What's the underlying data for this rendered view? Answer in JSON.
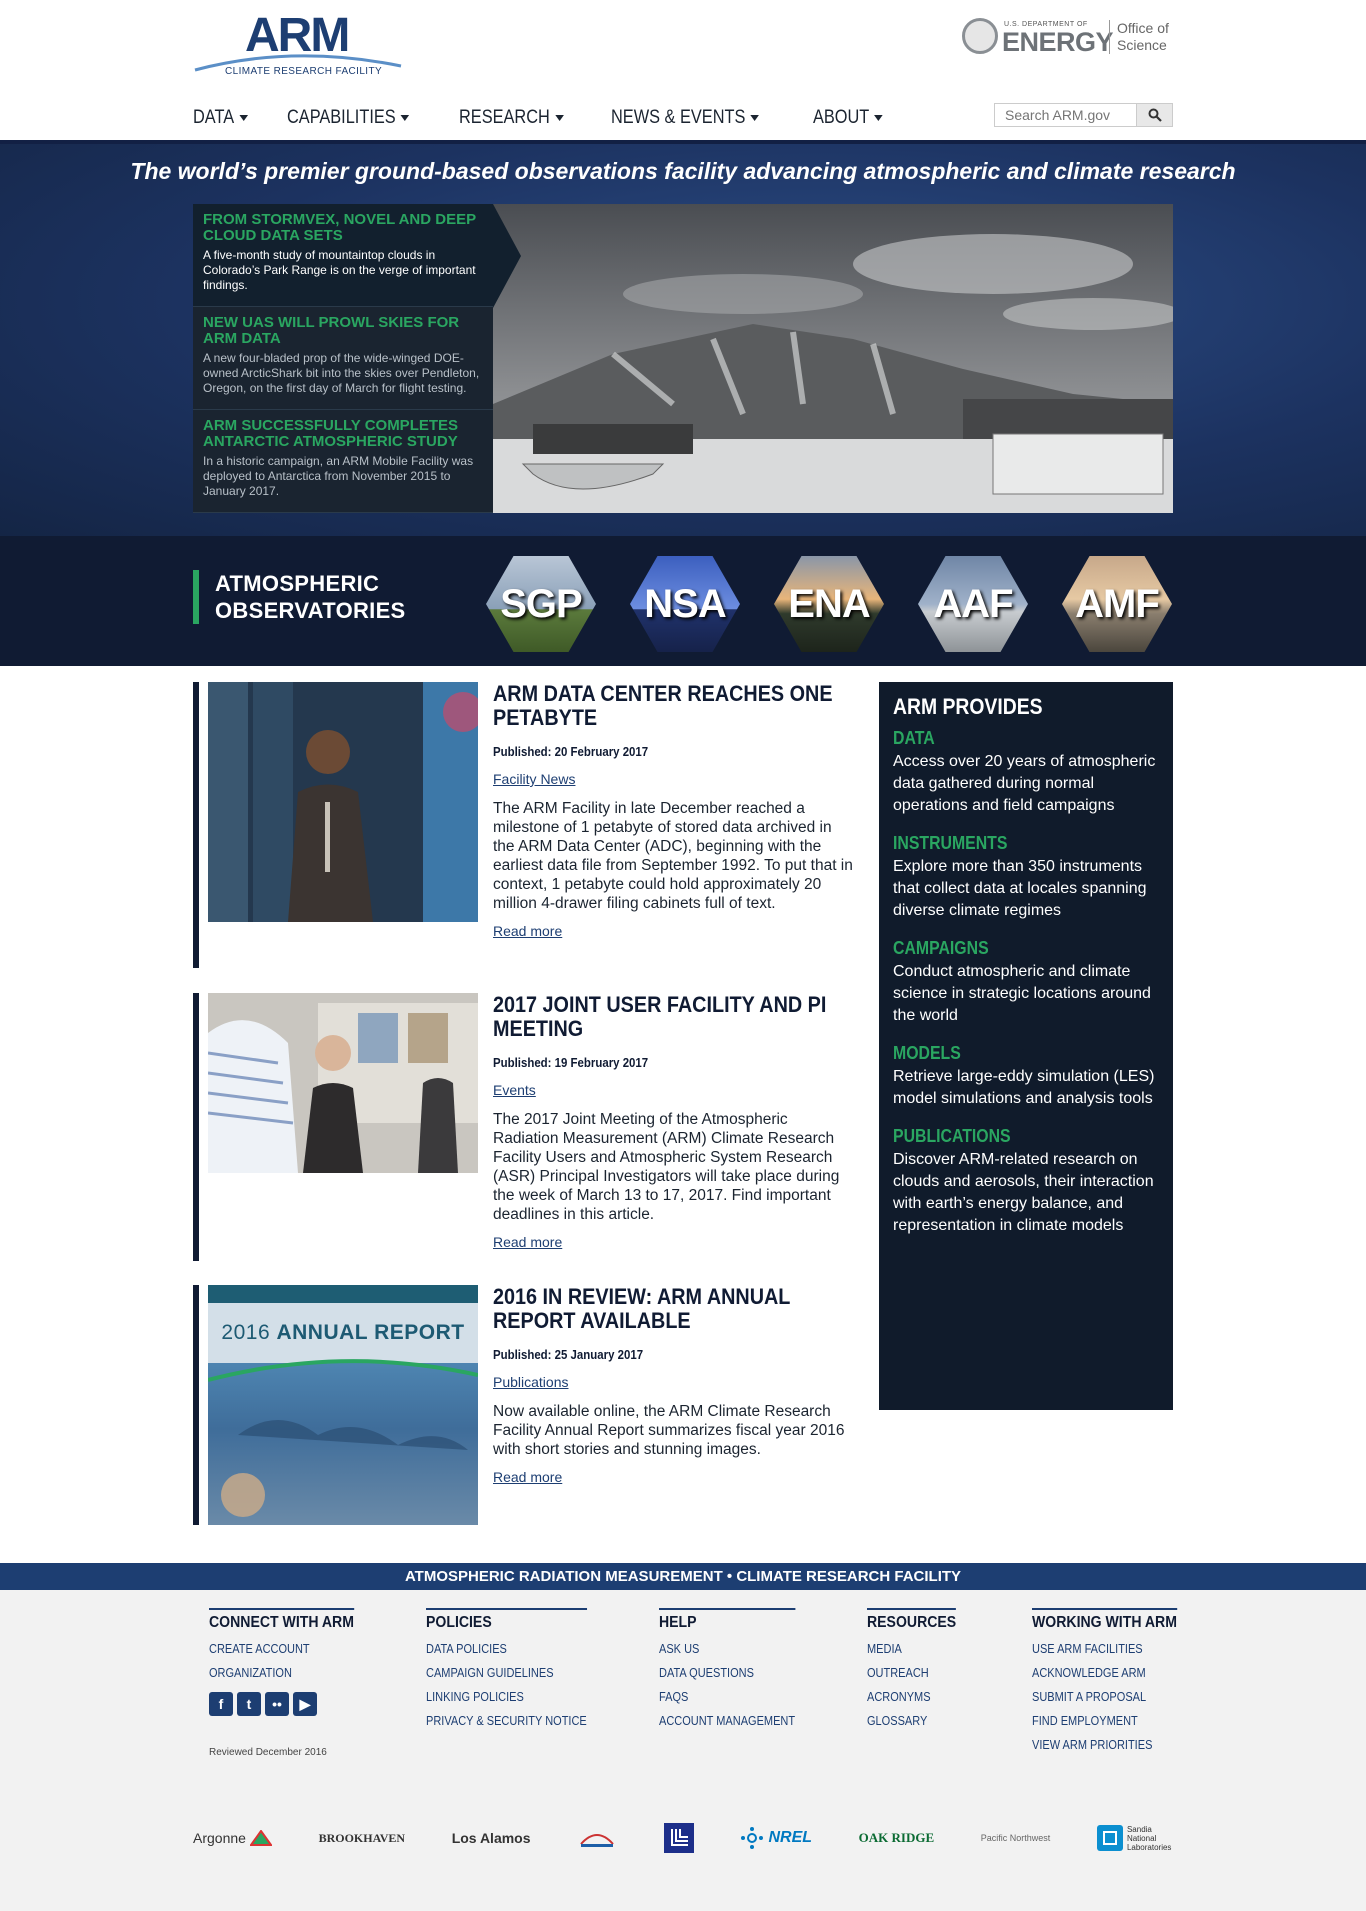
{
  "header": {
    "logo_text": "ARM",
    "logo_subtitle": "CLIMATE RESEARCH FACILITY",
    "doe_small": "U.S. DEPARTMENT OF",
    "doe_big": "ENERGY",
    "doe_office": "Office of Science"
  },
  "nav": {
    "items": [
      {
        "label": "DATA"
      },
      {
        "label": "CAPABILITIES"
      },
      {
        "label": "RESEARCH"
      },
      {
        "label": "NEWS & EVENTS"
      },
      {
        "label": "ABOUT"
      }
    ]
  },
  "search": {
    "placeholder": "Search ARM.gov",
    "icon": "search-icon"
  },
  "hero": {
    "tagline": "The world’s premier ground-based observations facility advancing atmospheric and climate research",
    "features": [
      {
        "title": "FROM STORMVEX, NOVEL AND DEEP CLOUD DATA SETS",
        "text": "A five-month study of mountaintop clouds in Colorado’s Park Range is on the verge of important findings."
      },
      {
        "title": "NEW UAS WILL PROWL SKIES FOR ARM DATA",
        "text": "A new four-bladed prop of the wide-winged DOE-owned ArcticShark bit into the skies over Pendleton, Oregon, on the first day of March for flight testing."
      },
      {
        "title": "ARM SUCCESSFULLY COMPLETES ANTARCTIC ATMOSPHERIC STUDY",
        "text": "In a historic campaign, an ARM Mobile Facility was deployed to Antarctica from November 2015 to January 2017."
      }
    ]
  },
  "observatories": {
    "title_line1": "ATMOSPHERIC",
    "title_line2": "OBSERVATORIES",
    "sites": [
      "SGP",
      "NSA",
      "ENA",
      "AAF",
      "AMF"
    ]
  },
  "articles": [
    {
      "title": "ARM DATA CENTER REACHES ONE PETABYTE",
      "date": "Published: 20 February 2017",
      "category": "Facility News",
      "text": "The ARM Facility in late December reached a milestone of 1 petabyte of stored data archived in the ARM Data Center (ADC), beginning with the earliest data file from September 1992. To put that in context, 1 petabyte could hold approximately 20 million 4-drawer filing cabinets full of text.",
      "more": "Read more"
    },
    {
      "title": "2017 JOINT USER FACILITY AND PI MEETING",
      "date": "Published: 19 February 2017",
      "category": "Events",
      "text": "The 2017 Joint Meeting of the Atmospheric Radiation Measurement (ARM) Climate Research Facility Users and Atmospheric System Research (ASR) Principal Investigators will take place during the week of March 13 to 17, 2017. Find important deadlines in this article.",
      "more": "Read more"
    },
    {
      "title": "2016 IN REVIEW: ARM ANNUAL REPORT AVAILABLE",
      "date": "Published: 25 January 2017",
      "category": "Publications",
      "text": "Now available online, the ARM Climate Research Facility Annual Report summarizes fiscal year 2016 with short stories and stunning images.",
      "more": "Read more",
      "image_text_1": "2016",
      "image_text_2": "ANNUAL REPORT"
    }
  ],
  "provides": {
    "title": "ARM PROVIDES",
    "items": [
      {
        "title": "DATA",
        "text": "Access over 20 years of atmospheric data gathered during normal operations and field campaigns"
      },
      {
        "title": "INSTRUMENTS",
        "text": "Explore more than 350 instruments that collect data at locales spanning diverse climate regimes"
      },
      {
        "title": "CAMPAIGNS",
        "text": "Conduct atmospheric and climate science in strategic locations around the world"
      },
      {
        "title": "MODELS",
        "text": "Retrieve large-eddy simulation (LES) model simulations and analysis tools"
      },
      {
        "title": "PUBLICATIONS",
        "text": "Discover ARM-related research on clouds and aerosols, their interaction with earth’s energy balance, and representation in climate models"
      }
    ]
  },
  "footer": {
    "band": "ATMOSPHERIC RADIATION MEASUREMENT  •  CLIMATE RESEARCH FACILITY",
    "columns": [
      {
        "heading": "CONNECT WITH ARM",
        "links": [
          "CREATE ACCOUNT",
          "ORGANIZATION"
        ]
      },
      {
        "heading": "POLICIES",
        "links": [
          "DATA POLICIES",
          "CAMPAIGN GUIDELINES",
          "LINKING POLICIES",
          "PRIVACY & SECURITY NOTICE"
        ]
      },
      {
        "heading": "HELP",
        "links": [
          "ASK US",
          "DATA QUESTIONS",
          "FAQS",
          "ACCOUNT MANAGEMENT"
        ]
      },
      {
        "heading": "RESOURCES",
        "links": [
          "MEDIA",
          "OUTREACH",
          "ACRONYMS",
          "GLOSSARY"
        ]
      },
      {
        "heading": "WORKING WITH ARM",
        "links": [
          "USE ARM FACILITIES",
          "ACKNOWLEDGE ARM",
          "SUBMIT A PROPOSAL",
          "FIND EMPLOYMENT",
          "VIEW ARM PRIORITIES"
        ]
      }
    ],
    "social_icons": [
      "facebook-icon",
      "twitter-icon",
      "flickr-icon",
      "youtube-icon"
    ],
    "reviewed": "Reviewed December 2016",
    "partners": [
      "Argonne",
      "BROOKHAVEN",
      "Los Alamos",
      "BERKELEY LAB",
      "LLNL",
      "NREL",
      "OAK RIDGE",
      "Pacific Northwest",
      "Sandia National Laboratories"
    ]
  },
  "colors": {
    "navy": "#101b33",
    "brand_blue": "#1d3e72",
    "accent_green": "#2aa661"
  }
}
